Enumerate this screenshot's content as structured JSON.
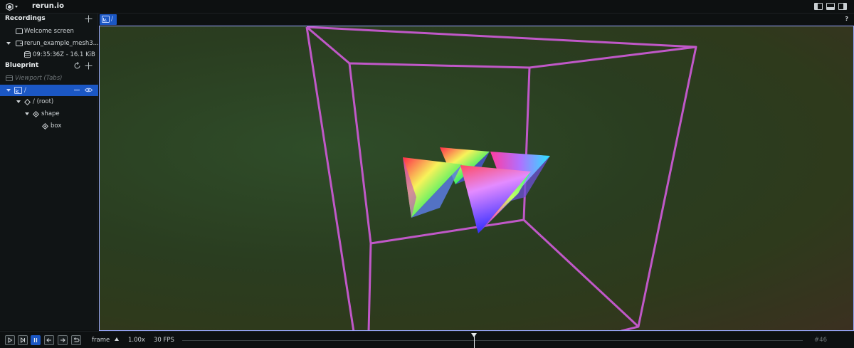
{
  "app": {
    "title": "rerun.io"
  },
  "recordings": {
    "title": "Recordings",
    "items": [
      {
        "label": "Welcome screen"
      },
      {
        "label": "rerun_example_mesh3..."
      },
      {
        "label": "09:35:36Z - 16.1 KiB"
      }
    ]
  },
  "blueprint": {
    "title": "Blueprint",
    "viewport_label": "Viewport (Tabs)",
    "tree": [
      {
        "label": "/"
      },
      {
        "label": "/ (root)"
      },
      {
        "label": "shape"
      },
      {
        "label": "box"
      }
    ]
  },
  "tabs": [
    {
      "label": "/"
    }
  ],
  "help_label": "?",
  "timeline": {
    "timeline_name": "frame",
    "speed": "1.00x",
    "fps": "30 FPS",
    "frame_label": "#46",
    "cursor_fraction": 0.47
  },
  "colors": {
    "accent": "#1b57c4",
    "box_wire": "#c058c8",
    "viewport_border": "#9aa8ff",
    "background": "#0d1011"
  },
  "icons": {
    "app_menu": "rerun-logo-icon",
    "recording": "recording-icon",
    "database": "database-icon",
    "space_view": "spatial-view-icon",
    "entity": "entity-icon",
    "reset": "reset-icon",
    "add": "plus-icon",
    "eye": "eye-icon"
  }
}
